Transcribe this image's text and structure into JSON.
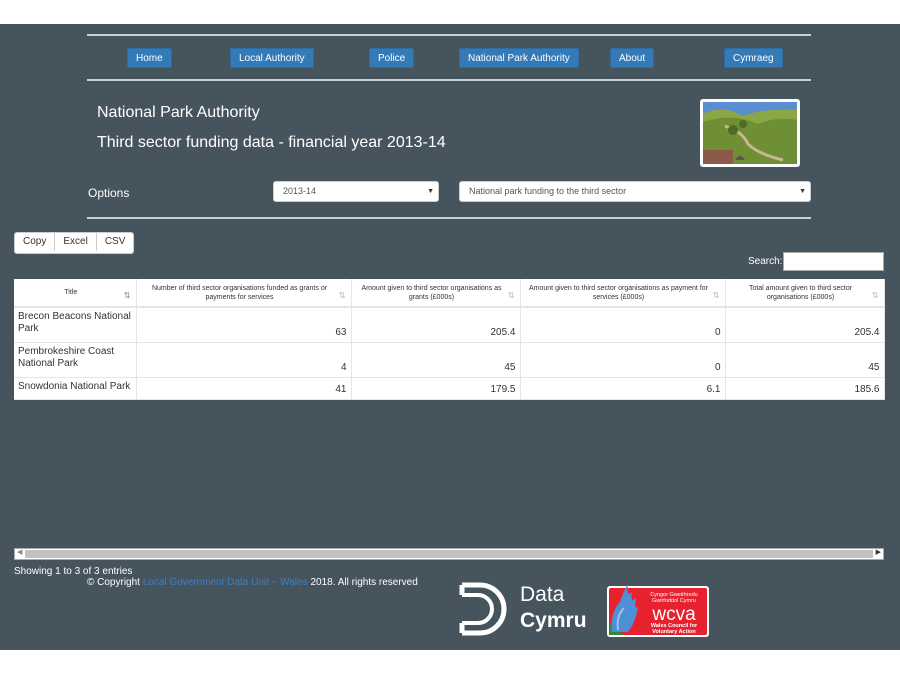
{
  "nav": {
    "items": [
      {
        "label": "Home"
      },
      {
        "label": "Local Authority"
      },
      {
        "label": "Police"
      },
      {
        "label": "National Park Authority"
      },
      {
        "label": "About"
      },
      {
        "label": "Cymraeg"
      }
    ]
  },
  "header": {
    "title": "National Park Authority",
    "subtitle": "Third sector funding data - financial year 2013-14",
    "thumbnail_icon": "landscape-photo"
  },
  "options": {
    "label": "Options",
    "year_select": {
      "selected": "2013-14"
    },
    "dataset_select": {
      "selected": "National park funding to the third sector"
    },
    "arrow_icon": "▼"
  },
  "export_buttons": {
    "copy": "Copy",
    "excel": "Excel",
    "csv": "CSV"
  },
  "search": {
    "label": "Search:",
    "value": ""
  },
  "table": {
    "columns": [
      "Title",
      "Number of third sector organisations funded as grants or payments for services",
      "Amount given to third sector organisations as grants (£000s)",
      "Amount given to third sector organisations as payment for services (£000s)",
      "Total amount given to third sector organisations (£000s)"
    ],
    "rows": [
      [
        "Brecon Beacons National Park",
        "63",
        "205.4",
        "0",
        "205.4"
      ],
      [
        "Pembrokeshire Coast National Park",
        "4",
        "45",
        "0",
        "45"
      ],
      [
        "Snowdonia National Park",
        "41",
        "179.5",
        "6.1",
        "185.6"
      ]
    ],
    "sort_icon_active": "⇅",
    "sort_icon": "⇅"
  },
  "info": "Showing 1 to 3 of 3 entries",
  "footer": {
    "copyright_prefix": "© Copyright",
    "copyright_link": "Local Government Data Unit ~ Wales",
    "copyright_suffix": "2018. All rights reserved",
    "logo1": {
      "line1": "Data",
      "line2": "Cymru"
    },
    "logo2": {
      "top1": "Cyngor Gweithredu",
      "top2": "Gwirfoddol Cymru",
      "main": "wcva",
      "bottom1": "Wales Council for",
      "bottom2": "Voluntary Action"
    }
  },
  "colors": {
    "background": "#46545e",
    "nav_button": "#337ab7",
    "link": "#3c7fbf",
    "wcva_red": "#e8212f"
  }
}
